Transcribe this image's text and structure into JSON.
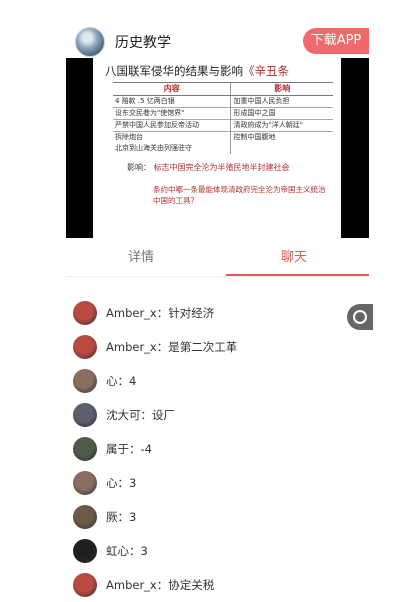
{
  "header": {
    "title": "历史教学",
    "download_label": "下载APP"
  },
  "video": {
    "slide": {
      "title_main": "八国联军侵华的结果与影响",
      "title_accent": "《辛丑条",
      "col_content": "内容",
      "col_effect": "影响",
      "left_rows": [
        "4 赔款 .5 亿两白银",
        "设东交民巷为\"使馆界\"",
        "严禁中国人民参加反帝活动",
        "拆除炮台",
        "北京到山海关由列强驻守"
      ],
      "right_rows": [
        "加重中国人民负担",
        "形成国中之国",
        "清政府成为\"洋人朝廷\"",
        "控制中国腹地"
      ],
      "effect_label": "影响：",
      "effect_text": "标志中国完全沦为半殖民地半封建社会",
      "question": "条约中哪一条最能体现清政府完全沦为帝国主义统治中国的工具？"
    }
  },
  "tabs": {
    "details": "详情",
    "chat": "聊天"
  },
  "chat": {
    "messages": [
      {
        "text": "Amber_x：针对经济",
        "avatar_color": "#b94a42"
      },
      {
        "text": "Amber_x：是第二次工革",
        "avatar_color": "#b94a42"
      },
      {
        "text": "心：4",
        "avatar_color": "#8a6e62"
      },
      {
        "text": "沈大可：设厂",
        "avatar_color": "#5b5f6f"
      },
      {
        "text": "属于：-4",
        "avatar_color": "#4f5b4a"
      },
      {
        "text": "心：3",
        "avatar_color": "#8a6e62"
      },
      {
        "text": "厥：3",
        "avatar_color": "#6d5a4b"
      },
      {
        "text": "虹心：3",
        "avatar_color": "#1f1f22"
      },
      {
        "text": "Amber_x：协定关税",
        "avatar_color": "#b94a42"
      }
    ]
  }
}
